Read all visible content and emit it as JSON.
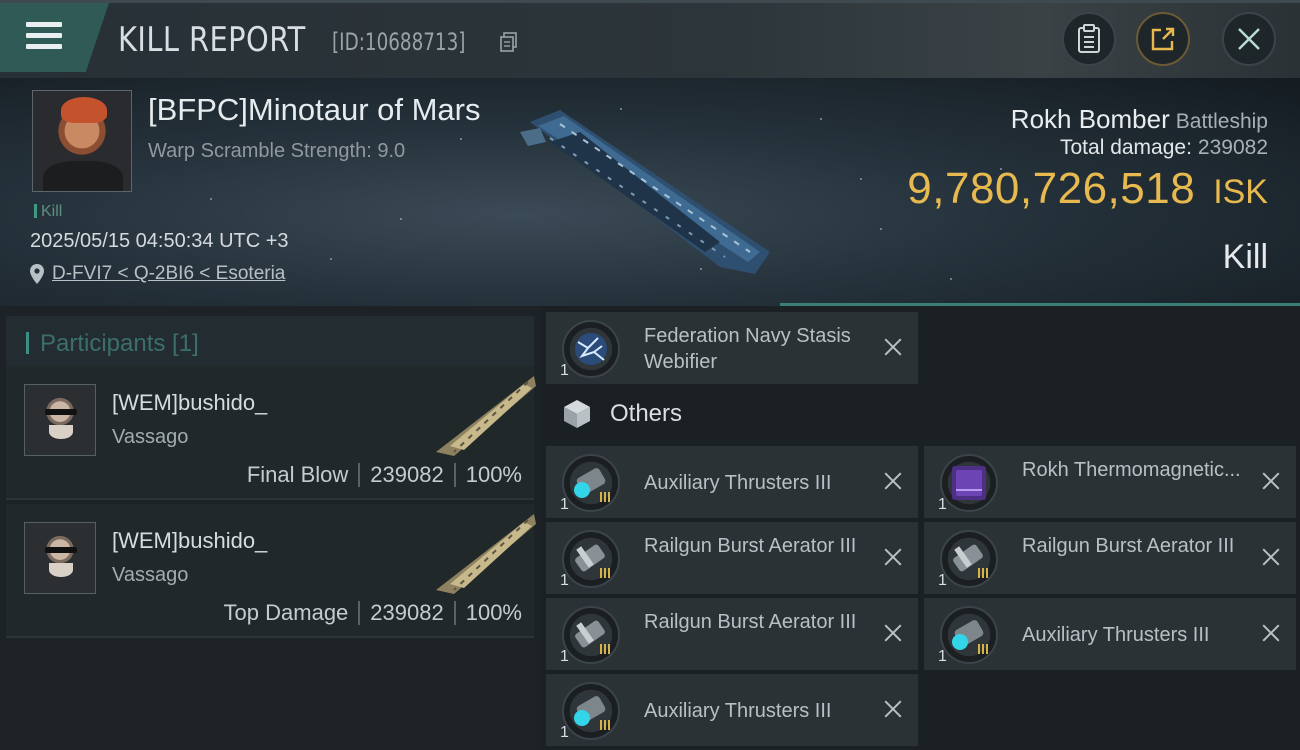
{
  "header": {
    "title": "KILL REPORT",
    "report_id": "[ID:10688713]"
  },
  "victim": {
    "name": "[BFPC]Minotaur of Mars",
    "warp_scramble": "Warp Scramble Strength: 9.0",
    "tag": "Kill",
    "datetime": "2025/05/15 04:50:34 UTC +3",
    "location": "D-FVI7 < Q-2BI6 < Esoteria",
    "ship_name": "Rokh Bomber",
    "ship_class": "Battleship",
    "total_damage_label": "Total damage:",
    "total_damage": "239082",
    "isk_value": "9,780,726,518",
    "isk_unit": "ISK",
    "status": "Kill"
  },
  "participants": {
    "label": "Participants [1]",
    "rows": [
      {
        "name": "[WEM]bushido_",
        "ship": "Vassago",
        "role": "Final Blow",
        "damage": "239082",
        "percent": "100%"
      },
      {
        "name": "[WEM]bushido_",
        "ship": "Vassago",
        "role": "Top Damage",
        "damage": "239082",
        "percent": "100%"
      }
    ]
  },
  "items": {
    "top": [
      {
        "name": "Federation Navy Stasis Webifier",
        "qty": "1",
        "icon": "stasis-webifier-icon"
      }
    ],
    "others_label": "Others",
    "others": [
      {
        "name": "Auxiliary Thrusters III",
        "qty": "1",
        "icon": "thruster-icon"
      },
      {
        "name": "Rokh Thermomagnetic...",
        "qty": "1",
        "icon": "blueprint-icon"
      },
      {
        "name": "Railgun Burst Aerator III",
        "qty": "1",
        "icon": "aerator-icon"
      },
      {
        "name": "Railgun Burst Aerator III",
        "qty": "1",
        "icon": "aerator-icon"
      },
      {
        "name": "Railgun Burst Aerator III",
        "qty": "1",
        "icon": "aerator-icon"
      },
      {
        "name": "Auxiliary Thrusters III",
        "qty": "1",
        "icon": "thruster-icon"
      },
      {
        "name": "Auxiliary Thrusters III",
        "qty": "1",
        "icon": "thruster-icon"
      }
    ]
  },
  "colors": {
    "accent_teal": "#3c8e86",
    "isk_gold": "#e7b94e",
    "menu_bg": "#2f5a55"
  }
}
